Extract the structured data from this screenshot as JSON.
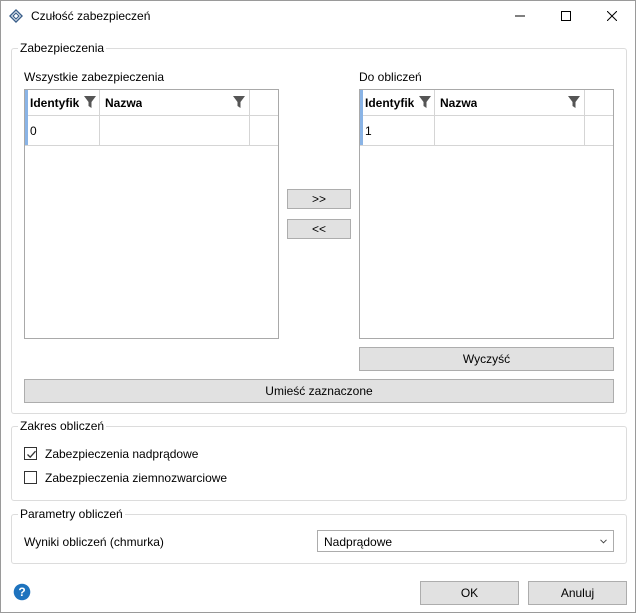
{
  "window": {
    "title": "Czułość zabezpieczeń"
  },
  "security_group": {
    "title": "Zabezpieczenia",
    "all_label": "Wszystkie zabezpieczenia",
    "selected_label": "Do obliczeń",
    "columns": [
      "Identyfik",
      "Nazwa"
    ],
    "all_rows": [
      {
        "id": "0",
        "name": ""
      }
    ],
    "selected_rows": [
      {
        "id": "1",
        "name": ""
      }
    ],
    "add_button": ">>",
    "remove_button": "<<",
    "clear_button": "Wyczyść",
    "place_button": "Umieść zaznaczone"
  },
  "range_group": {
    "title": "Zakres obliczeń",
    "overcurrent": {
      "label": "Zabezpieczenia nadprądowe",
      "checked": true
    },
    "earth_fault": {
      "label": "Zabezpieczenia ziemnozwarciowe",
      "checked": false
    }
  },
  "params_group": {
    "title": "Parametry obliczeń",
    "results_label": "Wyniki obliczeń (chmurka)",
    "results_value": "Nadprądowe"
  },
  "footer": {
    "ok_label": "OK",
    "cancel_label": "Anuluj"
  },
  "colors": {
    "accent": "#8ab4e6",
    "help": "#1e73be"
  }
}
